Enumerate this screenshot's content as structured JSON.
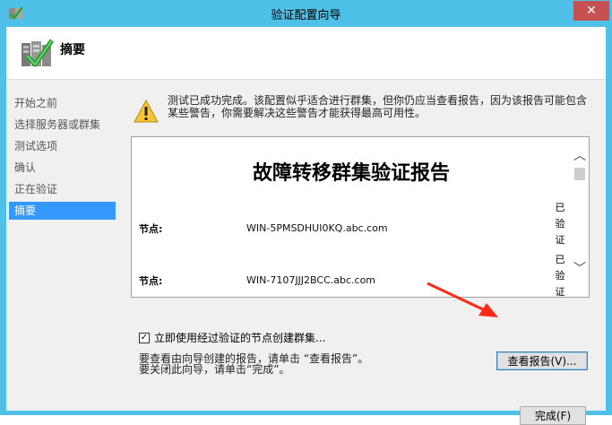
{
  "window": {
    "title": "验证配置向导",
    "close_glyph": "✕",
    "icon": "wizard-icon"
  },
  "header": {
    "title": "摘要",
    "icon": "cluster-validation-check-icon"
  },
  "sidebar": {
    "items": [
      {
        "label": "开始之前",
        "selected": false
      },
      {
        "label": "选择服务器或群集",
        "selected": false
      },
      {
        "label": "测试选项",
        "selected": false
      },
      {
        "label": "确认",
        "selected": false
      },
      {
        "label": "正在验证",
        "selected": false
      },
      {
        "label": "摘要",
        "selected": true
      }
    ]
  },
  "warning": {
    "icon": "warning-icon",
    "line1": "测试已成功完成。该配置似乎适合进行群集，但你仍应当查看报告，因为该报告可能包含",
    "line2": "某些警告，你需要解决这些警告才能获得最高可用性。"
  },
  "report": {
    "title": "故障转移群集验证报告",
    "rows": [
      {
        "label": "节点:",
        "value": "WIN-5PMSDHUI0KQ.abc.com",
        "status": [
          "已",
          "验",
          "证"
        ]
      },
      {
        "label": "节点:",
        "value": "WIN-7107JJJ2BCC.abc.com",
        "status": [
          "已",
          "验",
          "证"
        ]
      }
    ],
    "scroll_up": "︿",
    "scroll_down": "﹀"
  },
  "checkbox": {
    "label": "立即使用经过验证的节点创建群集...",
    "checked": true,
    "mark": "✓"
  },
  "info": {
    "line1": "要查看由向导创建的报告，请单击 “查看报告”。",
    "line2": "要关闭此向导，请单击“完成”。"
  },
  "buttons": {
    "view_report": "查看报告(V)...",
    "finish": "完成(F)"
  },
  "colors": {
    "title_bar": "#4fc1e9",
    "close_button": "#c75050",
    "selected_nav": "#3399ff",
    "arrow": "#ff2a1a"
  }
}
